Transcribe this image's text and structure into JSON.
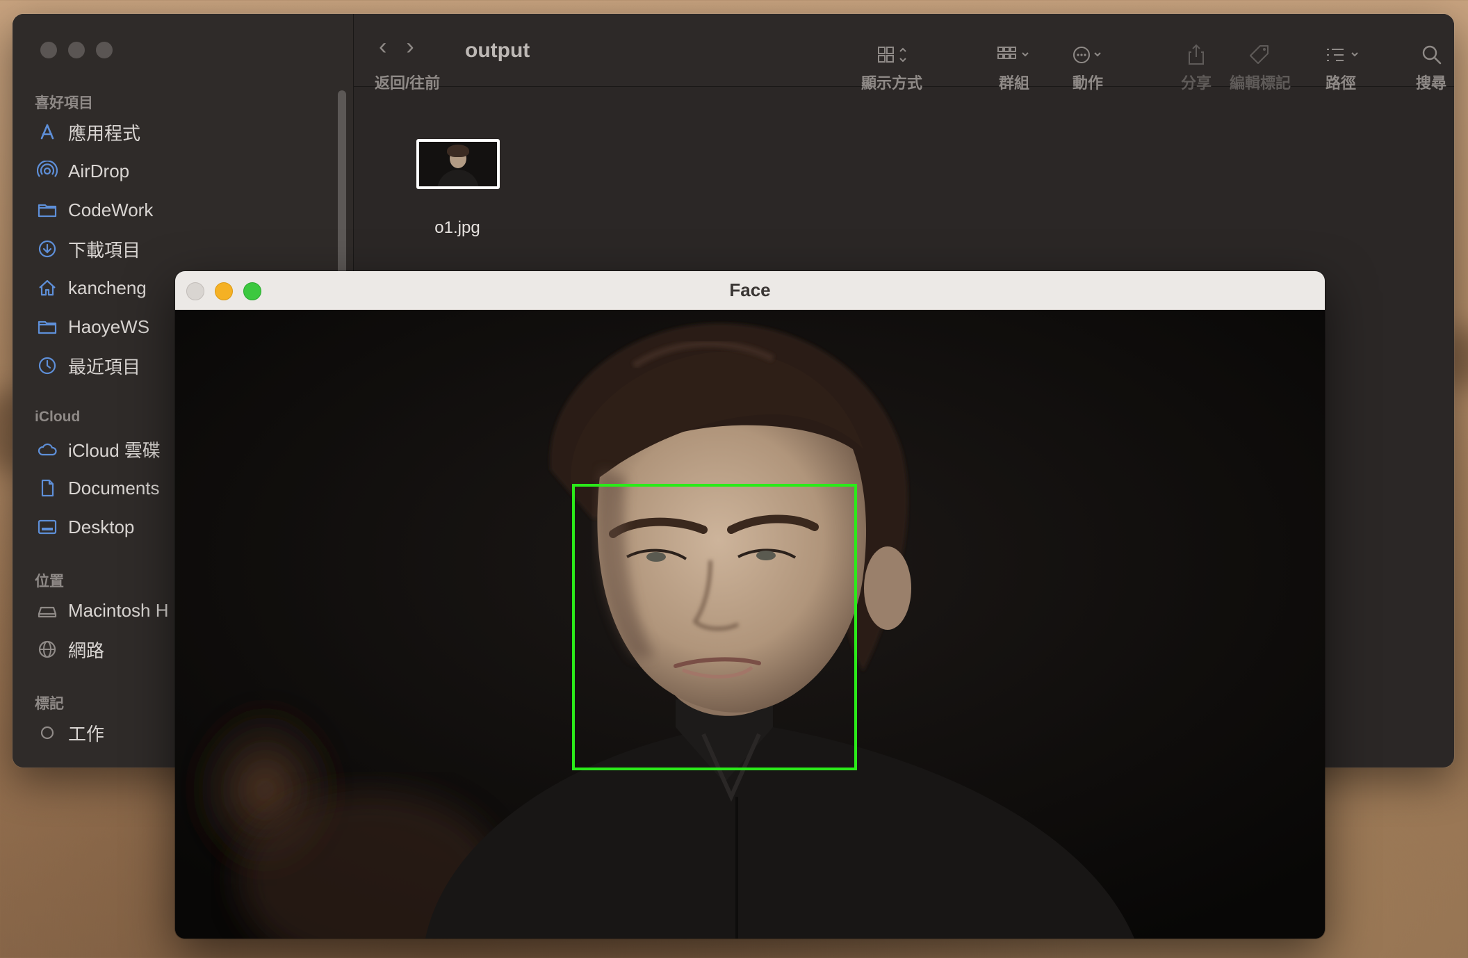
{
  "finder": {
    "sidebar": {
      "sections": [
        {
          "title": "喜好項目",
          "items": [
            {
              "label": "應用程式",
              "icon": "applications-icon"
            },
            {
              "label": "AirDrop",
              "icon": "airdrop-icon"
            },
            {
              "label": "CodeWork",
              "icon": "folder-icon"
            },
            {
              "label": "下載項目",
              "icon": "downloads-icon"
            },
            {
              "label": "kancheng",
              "icon": "home-icon"
            },
            {
              "label": "HaoyeWS",
              "icon": "folder-icon"
            },
            {
              "label": "最近項目",
              "icon": "recents-icon"
            }
          ]
        },
        {
          "title": "iCloud",
          "items": [
            {
              "label": "iCloud 雲碟",
              "icon": "icloud-icon"
            },
            {
              "label": "Documents",
              "icon": "document-icon"
            },
            {
              "label": "Desktop",
              "icon": "desktop-icon"
            }
          ]
        },
        {
          "title": "位置",
          "items": [
            {
              "label": "Macintosh H",
              "icon": "disk-icon"
            },
            {
              "label": "網路",
              "icon": "network-icon"
            }
          ]
        },
        {
          "title": "標記",
          "items": [
            {
              "label": "工作",
              "icon": "tag-circle-icon"
            }
          ]
        }
      ]
    },
    "toolbar": {
      "title": "output",
      "nav_label": "返回/往前",
      "view_label": "顯示方式",
      "group_label": "群組",
      "action_label": "動作",
      "share_label": "分享",
      "tags_label": "編輯標記",
      "path_label": "路徑",
      "search_label": "搜尋"
    },
    "files": [
      {
        "name": "o1.jpg"
      }
    ]
  },
  "face_window": {
    "title": "Face",
    "detection": {
      "color": "#2bea1a"
    }
  },
  "colors": {
    "close": "#d9d5d1",
    "minimize": "#f5b124",
    "zoom": "#3cc83f",
    "finder_bg": "#2b2726",
    "accent_icon": "#5e8fd8"
  }
}
